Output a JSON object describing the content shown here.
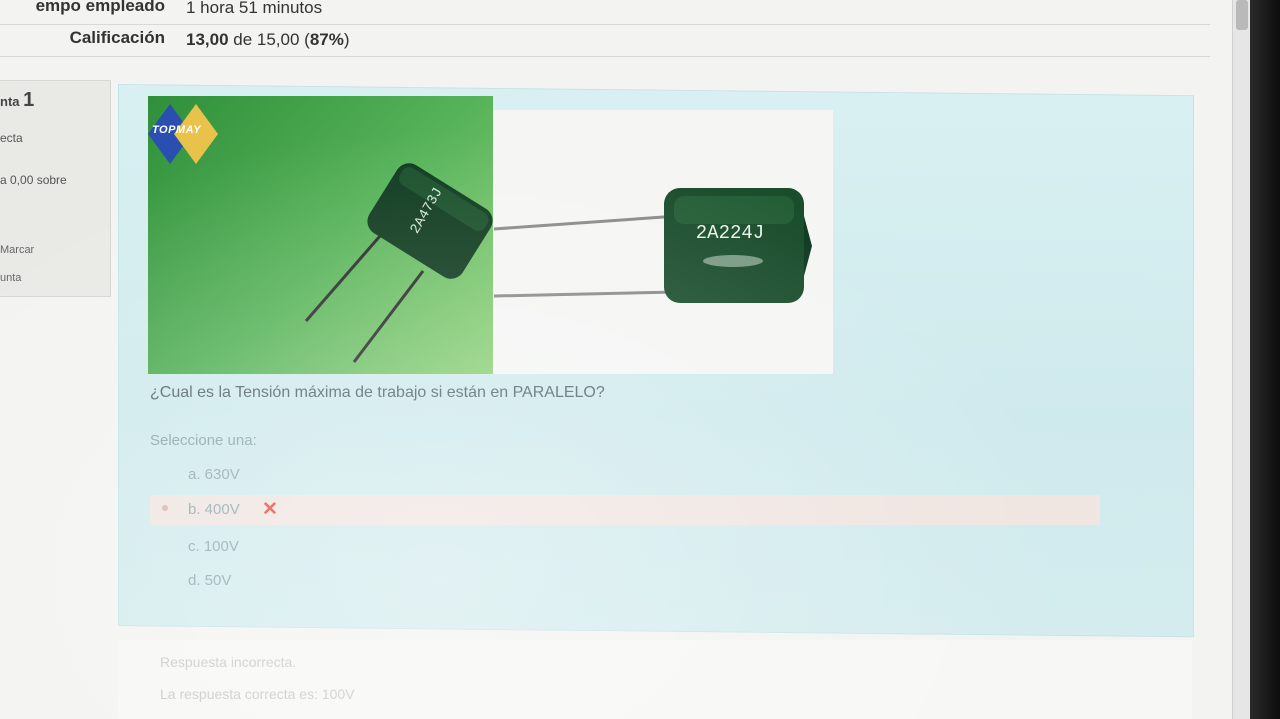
{
  "summary": {
    "time_label": "empo empleado",
    "time_value": "1 hora 51 minutos",
    "grade_label": "Calificación",
    "grade_score": "13,00",
    "grade_rest": " de 15,00 (",
    "grade_pct": "87%",
    "grade_close": ")"
  },
  "info": {
    "question_prefix": "nta",
    "question_number": "1",
    "state": "ecta",
    "grade": "a 0,00 sobre",
    "flag_line1": "Marcar",
    "flag_line2": "unta"
  },
  "question": {
    "logo_text": "TOPMAY",
    "capacitor_left_code": "2A473J",
    "capacitor_right_code": "2A224J",
    "text": "¿Cual es la Tensión máxima de trabajo si están en PARALELO?",
    "prompt": "Seleccione una:",
    "answers": [
      {
        "label": "a. 630V",
        "selected": false
      },
      {
        "label": "b. 400V",
        "selected": true,
        "mark": "✕"
      },
      {
        "label": "c. 100V",
        "selected": false
      },
      {
        "label": "d. 50V",
        "selected": false
      }
    ]
  },
  "feedback": {
    "result": "Respuesta incorrecta.",
    "correct": "La respuesta correcta es: 100V"
  },
  "colors": {
    "question_bg": "#d4ecee",
    "incorrect_row": "#f5e4de",
    "wrong_mark": "#e34a3d"
  }
}
